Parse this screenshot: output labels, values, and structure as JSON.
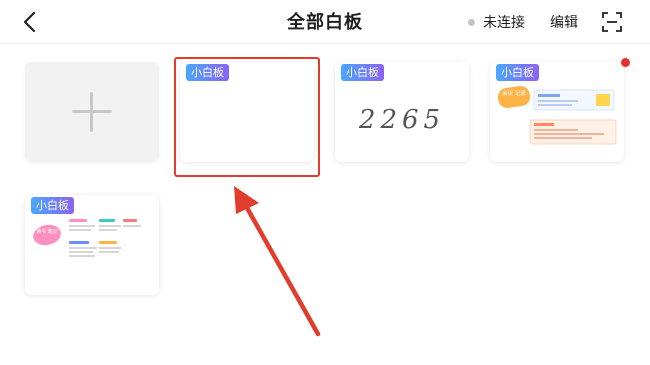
{
  "header": {
    "title": "全部白板",
    "status": "未连接",
    "status_dot_color": "#c4c4c4",
    "edit_label": "编辑",
    "back_icon": "chevron-left-icon",
    "scan_icon": "scan-icon"
  },
  "board_tag_gradient": [
    "#4aa7ff",
    "#8a63f2"
  ],
  "boards": [
    {
      "tag": "小白板",
      "content": "blank",
      "selected": true
    },
    {
      "tag": "小白板",
      "content": "handwriting",
      "handwriting": "2265"
    },
    {
      "tag": "小白板",
      "content": "notes",
      "sticker_text": "会议 记录"
    },
    {
      "tag": "小白板",
      "content": "notes",
      "sticker_text": "读书 笔记"
    }
  ],
  "add_board": {
    "icon": "plus-icon"
  },
  "annotation": {
    "color": "#e13c2c"
  }
}
